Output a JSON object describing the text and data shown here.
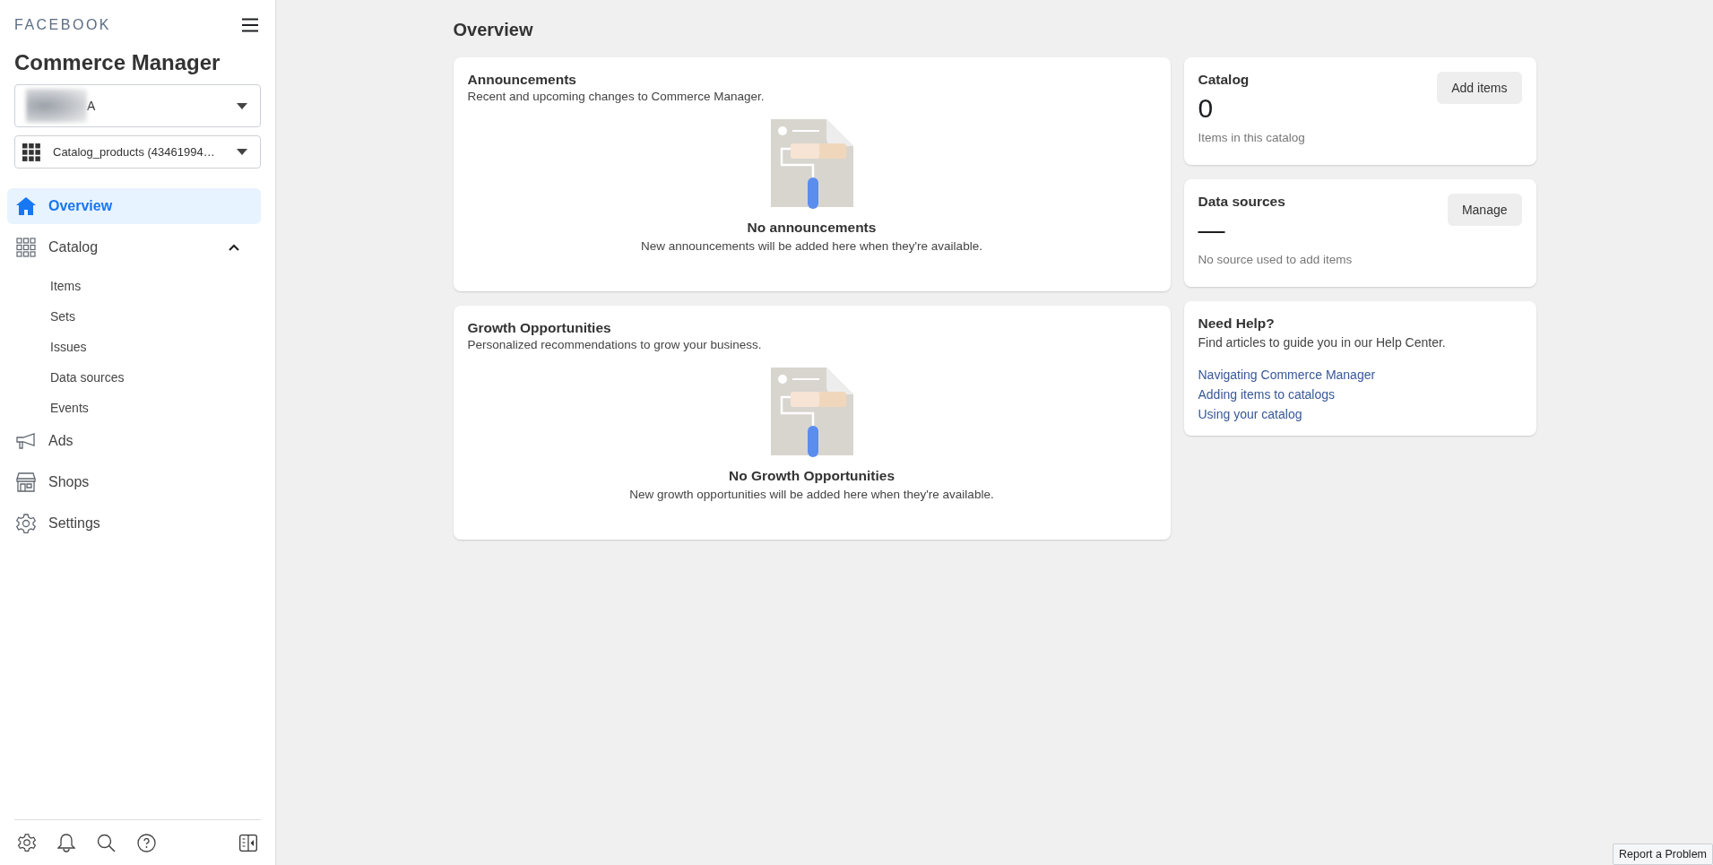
{
  "sidebar": {
    "brand": "FACEBOOK",
    "title": "Commerce Manager",
    "account_selector": {
      "value": "A"
    },
    "catalog_selector": {
      "value": "Catalog_products (43461994…"
    },
    "nav": [
      {
        "label": "Overview",
        "selected": true
      },
      {
        "label": "Catalog",
        "selected": false,
        "expanded": true,
        "children": [
          {
            "label": "Items",
            "selected": false
          },
          {
            "label": "Sets",
            "selected": false
          },
          {
            "label": "Issues",
            "selected": false
          },
          {
            "label": "Data sources",
            "selected": false
          },
          {
            "label": "Events",
            "selected": false
          }
        ]
      },
      {
        "label": "Ads",
        "selected": false
      },
      {
        "label": "Shops",
        "selected": false
      },
      {
        "label": "Settings",
        "selected": false
      }
    ]
  },
  "page_title": "Overview",
  "announcements": {
    "title": "Announcements",
    "subtitle": "Recent and upcoming changes to Commerce Manager.",
    "empty_title": "No announcements",
    "empty_text": "New announcements will be added here when they're available."
  },
  "growth": {
    "title": "Growth Opportunities",
    "subtitle": "Personalized recommendations to grow your business.",
    "empty_title": "No Growth Opportunities",
    "empty_text": "New growth opportunities will be added here when they're available."
  },
  "catalog_card": {
    "title": "Catalog",
    "value": "0",
    "caption": "Items in this catalog",
    "button": "Add items"
  },
  "data_sources_card": {
    "title": "Data sources",
    "value": "—",
    "caption": "No source used to add items",
    "button": "Manage"
  },
  "help_card": {
    "title": "Need Help?",
    "subtitle": "Find articles to guide you in our Help Center.",
    "links": [
      "Navigating Commerce Manager",
      "Adding items to catalogs",
      "Using your catalog"
    ]
  },
  "report_button": "Report a Problem"
}
